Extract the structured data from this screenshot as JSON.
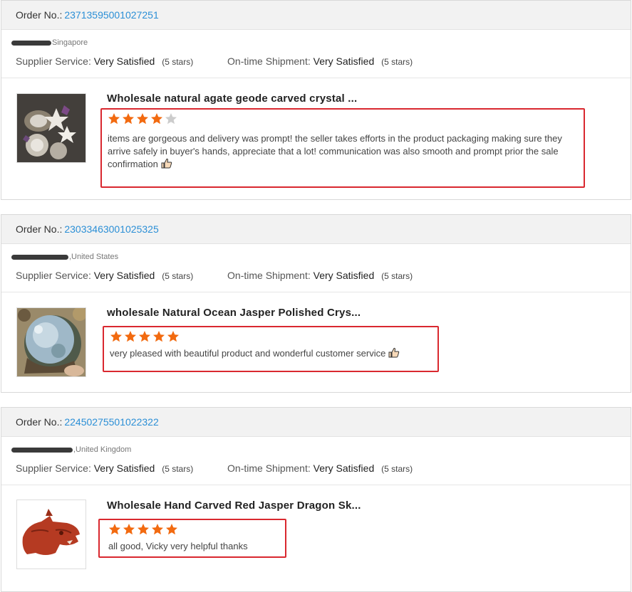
{
  "orders": [
    {
      "order_label": "Order No.:",
      "order_no": "23713595001027251",
      "buyer_country": "Singapore",
      "supplier_service_label": "Supplier Service:",
      "supplier_service_value": "Very Satisfied",
      "supplier_service_stars": "(5 stars)",
      "shipment_label": "On-time Shipment:",
      "shipment_value": "Very Satisfied",
      "shipment_stars": "(5 stars)",
      "product_title": "Wholesale natural agate geode carved crystal ...",
      "rating": 4,
      "review": "items are gorgeous and delivery was prompt! the seller takes efforts in the product packaging making sure they arrive safely in buyer's hands, appreciate that a lot! communication was also smooth and prompt prior the sale confirmation"
    },
    {
      "order_label": "Order No.:",
      "order_no": "23033463001025325",
      "buyer_country": ",United States",
      "supplier_service_label": "Supplier Service:",
      "supplier_service_value": "Very Satisfied",
      "supplier_service_stars": "(5 stars)",
      "shipment_label": "On-time Shipment:",
      "shipment_value": "Very Satisfied",
      "shipment_stars": "(5 stars)",
      "product_title": "wholesale Natural Ocean Jasper Polished Crys...",
      "rating": 5,
      "review": "very pleased with beautiful product and wonderful customer service"
    },
    {
      "order_label": "Order No.:",
      "order_no": "22450275501022322",
      "buyer_country": ",United Kingdom",
      "supplier_service_label": "Supplier Service:",
      "supplier_service_value": "Very Satisfied",
      "supplier_service_stars": "(5 stars)",
      "shipment_label": "On-time Shipment:",
      "shipment_value": "Very Satisfied",
      "shipment_stars": "(5 stars)",
      "product_title": "Wholesale Hand Carved Red Jasper Dragon Sk...",
      "rating": 5,
      "review": "all good, Vicky very helpful thanks"
    }
  ],
  "colors": {
    "star_filled": "#f26a10",
    "star_empty": "#cccccc",
    "highlight_box": "#d9282f",
    "order_link": "#2b8fd6",
    "header_bg": "#f2f2f2"
  },
  "icons": [
    "star-icon",
    "thumbs-up-icon"
  ]
}
